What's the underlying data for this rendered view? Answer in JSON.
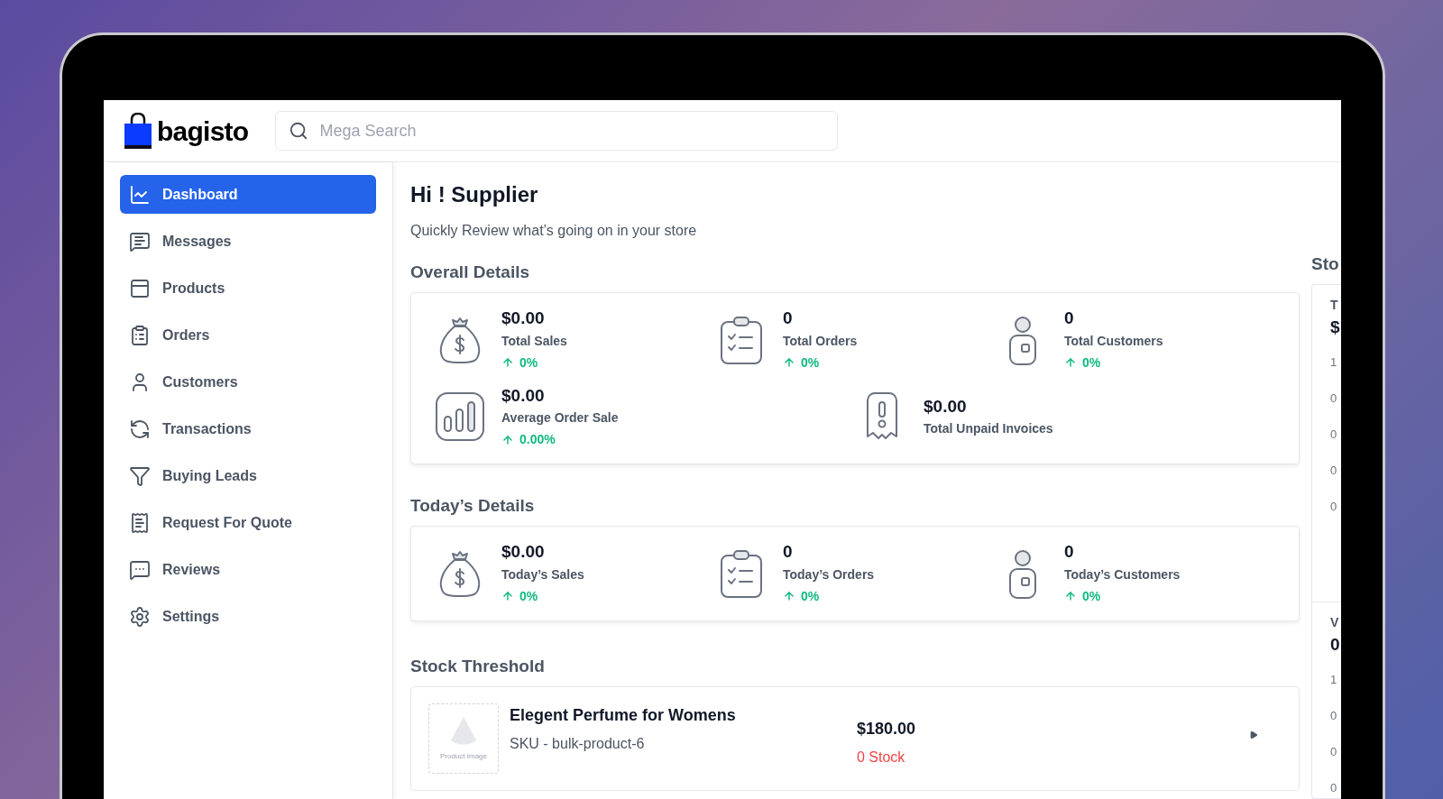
{
  "brand": {
    "name": "bagisto"
  },
  "search": {
    "placeholder": "Mega Search"
  },
  "sidebar": {
    "items": [
      {
        "kind": "dashboard",
        "label": "Dashboard",
        "selected": true
      },
      {
        "kind": "messages",
        "label": "Messages",
        "selected": false
      },
      {
        "kind": "products",
        "label": "Products",
        "selected": false
      },
      {
        "kind": "orders",
        "label": "Orders",
        "selected": false
      },
      {
        "kind": "customers",
        "label": "Customers",
        "selected": false
      },
      {
        "kind": "transactions",
        "label": "Transactions",
        "selected": false
      },
      {
        "kind": "leads",
        "label": "Buying Leads",
        "selected": false
      },
      {
        "kind": "quote",
        "label": "Request For Quote",
        "selected": false
      },
      {
        "kind": "reviews",
        "label": "Reviews",
        "selected": false
      },
      {
        "kind": "settings",
        "label": "Settings",
        "selected": false
      }
    ]
  },
  "greeting": {
    "title": "Hi ! Supplier",
    "subtitle": "Quickly Review what’s going on in your store"
  },
  "overall": {
    "title": "Overall Details",
    "rows": [
      {
        "stats": [
          {
            "kind": "sales",
            "value": "$0.00",
            "label": "Total Sales",
            "change": "0%"
          },
          {
            "kind": "orders",
            "value": "0",
            "label": "Total Orders",
            "change": "0%"
          },
          {
            "kind": "customers",
            "value": "0",
            "label": "Total Customers",
            "change": "0%"
          }
        ]
      },
      {
        "stats": [
          {
            "kind": "average",
            "value": "$0.00",
            "label": "Average Order Sale",
            "change": "0.00%"
          },
          {
            "kind": "unpaid",
            "value": "$0.00",
            "label": "Total Unpaid Invoices"
          }
        ]
      }
    ]
  },
  "today": {
    "title": "Today’s Details",
    "rows": [
      {
        "stats": [
          {
            "kind": "sales",
            "value": "$0.00",
            "label": "Today’s Sales",
            "change": "0%"
          },
          {
            "kind": "orders",
            "value": "0",
            "label": "Today’s Orders",
            "change": "0%"
          },
          {
            "kind": "customers",
            "value": "0",
            "label": "Today’s Customers",
            "change": "0%"
          }
        ]
      }
    ]
  },
  "stock": {
    "title": "Stock Threshold",
    "items": [
      {
        "image_label": "Product Image",
        "name": "Elegent Perfume for Womens",
        "sku": "SKU - bulk-product-6",
        "price": "$180.00",
        "stock": "0 Stock"
      }
    ]
  },
  "side_panel": {
    "title": "Sto",
    "cards": [
      {
        "label": "T",
        "value": "$",
        "ticks": [
          "1",
          "0",
          "0",
          "0",
          "0"
        ]
      },
      {
        "label": "V",
        "value": "0",
        "ticks": [
          "1",
          "0",
          "0",
          "0"
        ]
      }
    ]
  }
}
